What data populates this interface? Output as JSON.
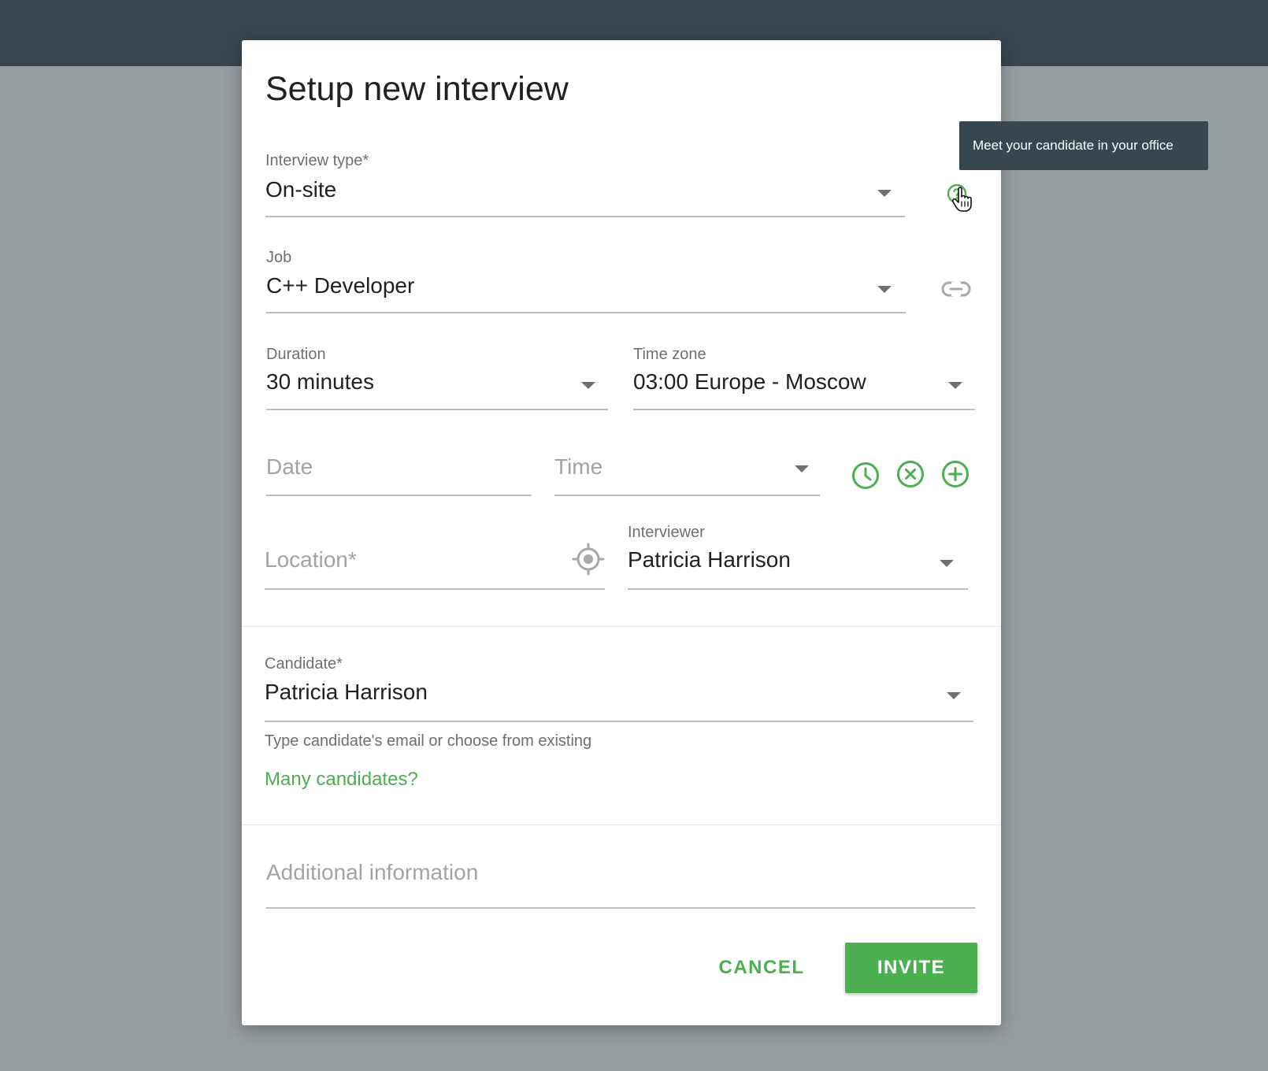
{
  "dialog": {
    "title": "Setup new interview"
  },
  "interview_type": {
    "label": "Interview type*",
    "value": "On-site",
    "help_tooltip": "Meet your candidate in your office"
  },
  "job": {
    "label": "Job",
    "value": "C++ Developer"
  },
  "duration": {
    "label": "Duration",
    "value": "30 minutes"
  },
  "time_zone": {
    "label": "Time zone",
    "value": "03:00 Europe - Moscow"
  },
  "date": {
    "placeholder": "Date"
  },
  "time": {
    "placeholder": "Time"
  },
  "location": {
    "placeholder": "Location*"
  },
  "interviewer": {
    "label": "Interviewer",
    "value": "Patricia Harrison"
  },
  "candidate": {
    "label": "Candidate*",
    "value": "Patricia Harrison",
    "hint": "Type candidate's email or choose from existing",
    "many_link": "Many candidates?"
  },
  "additional_info": {
    "placeholder": "Additional information"
  },
  "actions": {
    "cancel_label": "CANCEL",
    "invite_label": "INVITE"
  },
  "icons": {
    "help": "help-circle-icon",
    "link": "link-icon",
    "clock": "clock-icon",
    "remove": "close-circle-icon",
    "add": "add-circle-icon",
    "locate": "crosshair-icon",
    "dropdown": "dropdown-arrow-icon",
    "cursor": "hand-cursor-icon"
  },
  "colors": {
    "accent": "#4caf50",
    "topbar": "#3a4750",
    "backdrop": "#979ea1",
    "tooltip_bg": "#37474f"
  }
}
